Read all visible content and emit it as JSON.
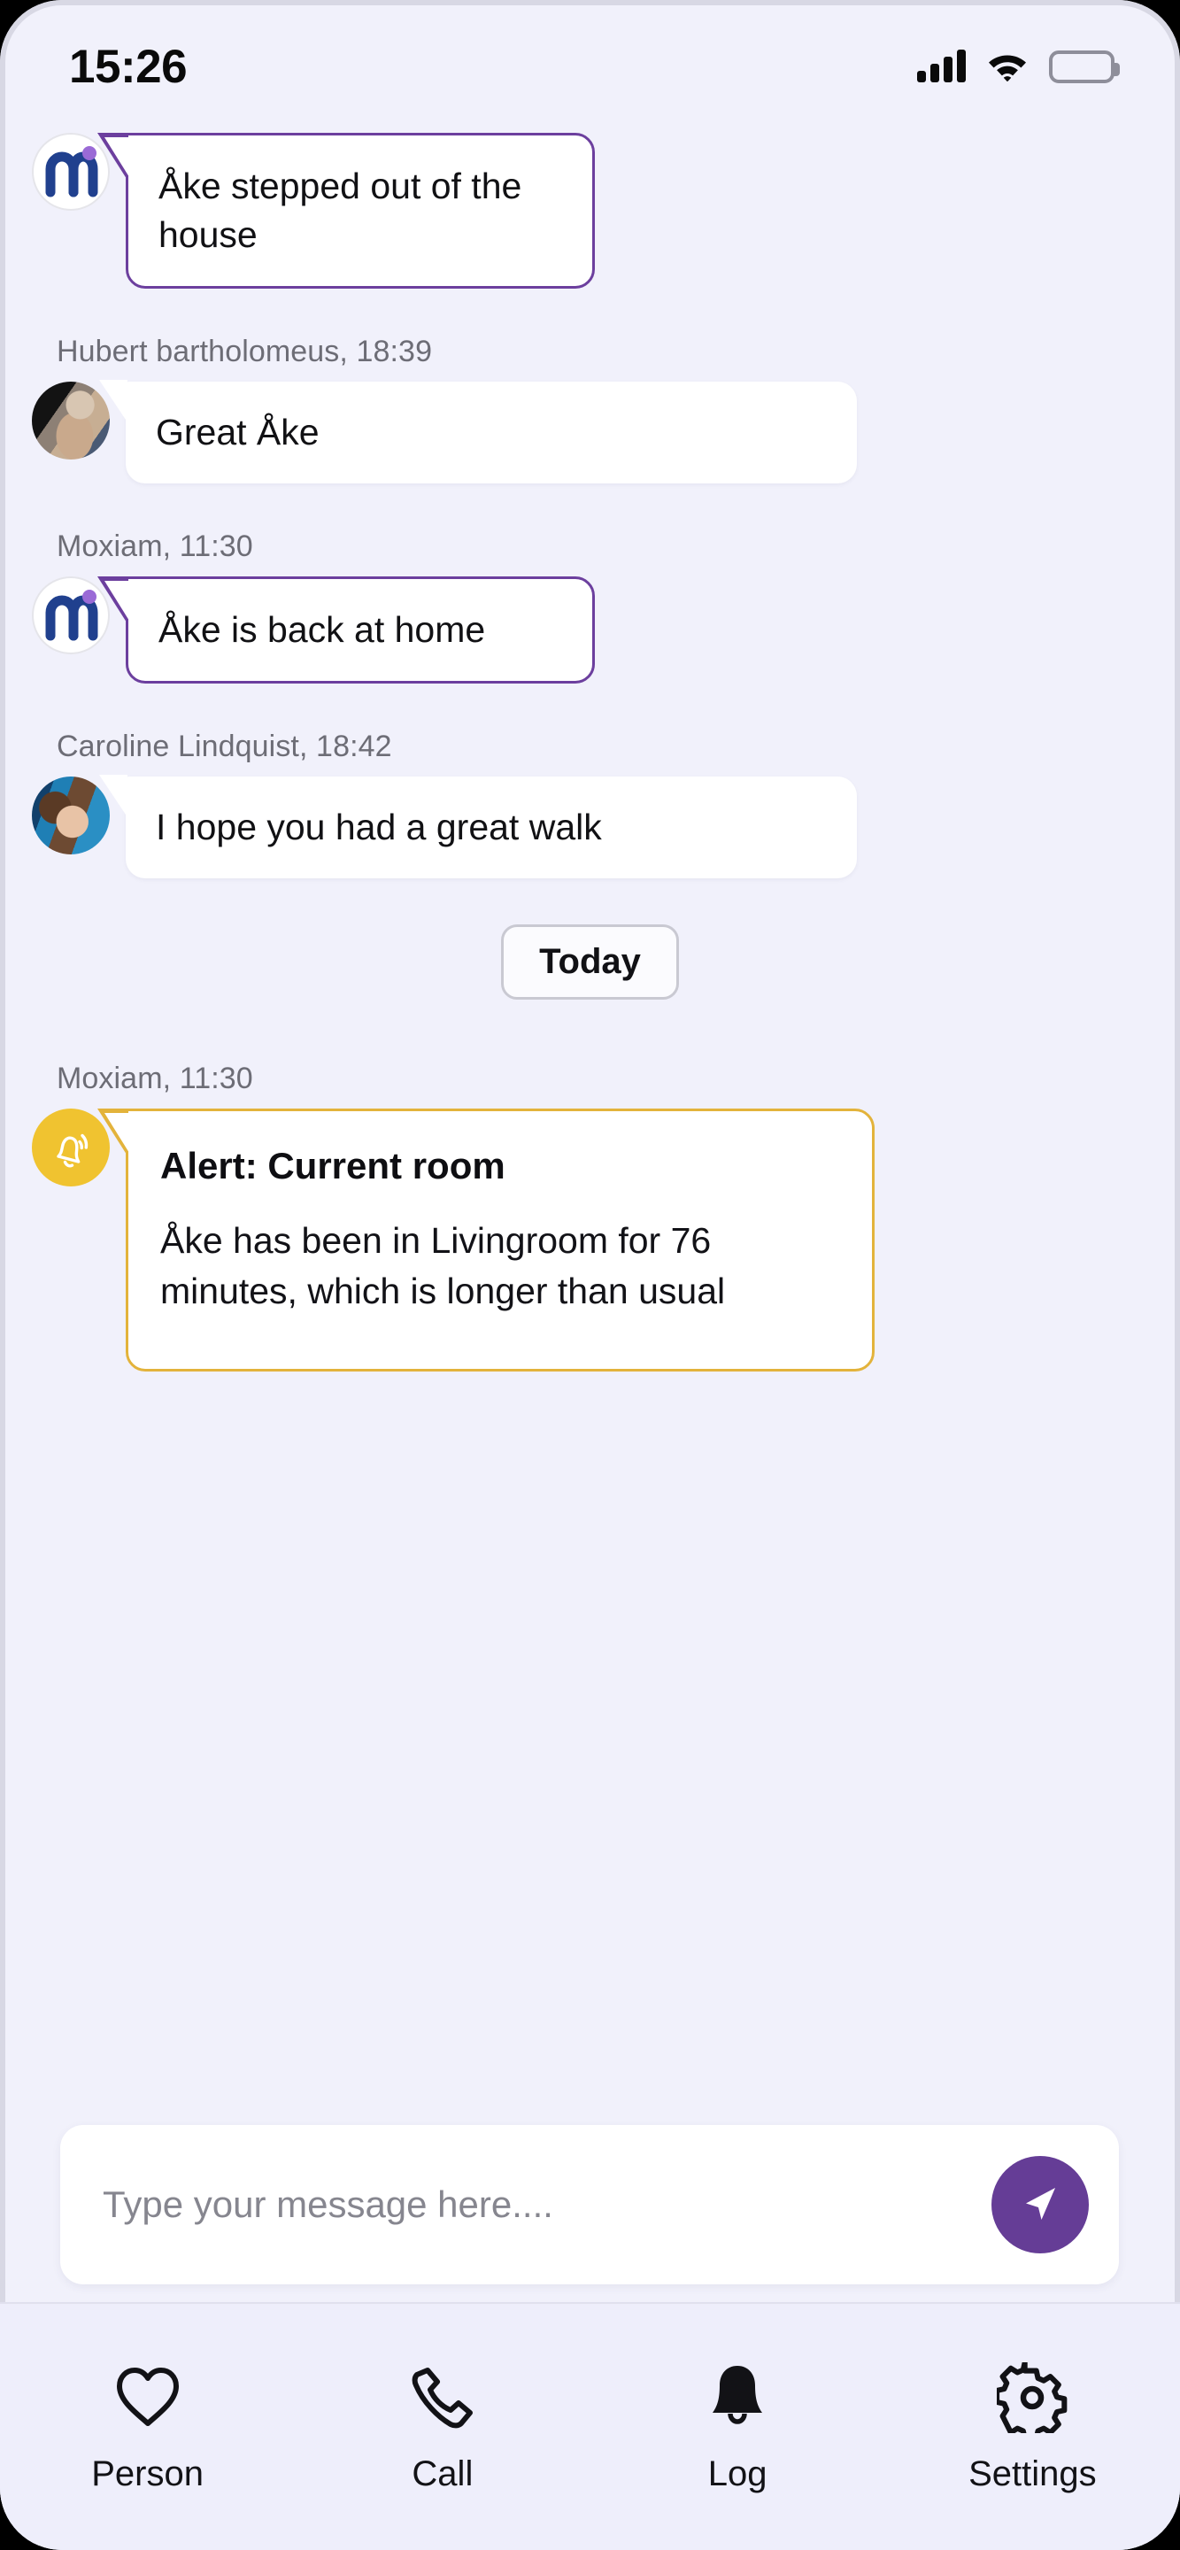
{
  "status_bar": {
    "time": "15:26",
    "signal_icon": "signal-bars-icon",
    "wifi_icon": "wifi-icon",
    "battery_icon": "battery-full-icon"
  },
  "chat": {
    "messages": [
      {
        "sender_line": "",
        "avatar": "moxiam-logo-avatar",
        "style": "purple",
        "text": "Åke stepped out of the house"
      },
      {
        "sender_line": "Hubert bartholomeus, 18:39",
        "avatar": "hubert-photo-avatar",
        "style": "plain",
        "text": "Great Åke"
      },
      {
        "sender_line": "Moxiam, 11:30",
        "avatar": "moxiam-logo-avatar",
        "style": "purple",
        "text": "Åke is back at home"
      },
      {
        "sender_line": "Caroline Lindquist, 18:42",
        "avatar": "caroline-photo-avatar",
        "style": "plain",
        "text": "I hope you had a great walk"
      }
    ],
    "day_divider": "Today",
    "alert": {
      "sender_line": "Moxiam, 11:30",
      "avatar": "alert-bell-avatar",
      "title": "Alert: Current room",
      "body": "Åke has been in Livingroom for 76 minutes, which is longer than usual"
    }
  },
  "composer": {
    "placeholder": "Type your message here....",
    "value": "",
    "send_icon": "send-paper-plane-icon"
  },
  "bottom_nav": {
    "items": [
      {
        "label": "Person",
        "icon": "heart-icon",
        "active": false
      },
      {
        "label": "Call",
        "icon": "phone-icon",
        "active": false
      },
      {
        "label": "Log",
        "icon": "bell-icon",
        "active": true
      },
      {
        "label": "Settings",
        "icon": "gear-icon",
        "active": false
      }
    ]
  },
  "colors": {
    "background": "#f1f1fb",
    "accent_purple": "#653d96",
    "bubble_border_purple": "#6c3f9e",
    "alert_border": "#e3b33b",
    "alert_avatar": "#f0c330",
    "logo_blue": "#20408e",
    "logo_dot_purple": "#9a6ad6"
  }
}
